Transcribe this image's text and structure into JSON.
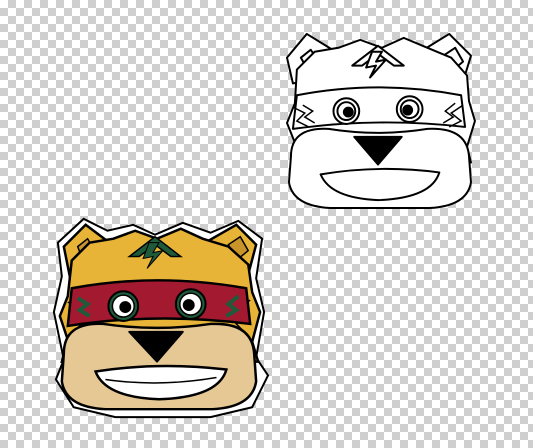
{
  "canvas": {
    "background": "transparent-checkerboard",
    "checker_light": "#ffffff",
    "checker_dark": "#cfcfcf"
  },
  "mascots": [
    {
      "id": "bear-head-color",
      "style": "full-color",
      "colors": {
        "fur": "#e8b437",
        "fur_shade": "#c9952b",
        "muzzle": "#e6c894",
        "headband": "#a3192f",
        "emblem": "#1f5a3a",
        "eye_ring": "#1f5a3a",
        "outline": "#000000",
        "teeth": "#ffffff"
      }
    },
    {
      "id": "bear-head-outline",
      "style": "line-art",
      "colors": {
        "stroke": "#000000",
        "fill": "#ffffff"
      }
    }
  ]
}
